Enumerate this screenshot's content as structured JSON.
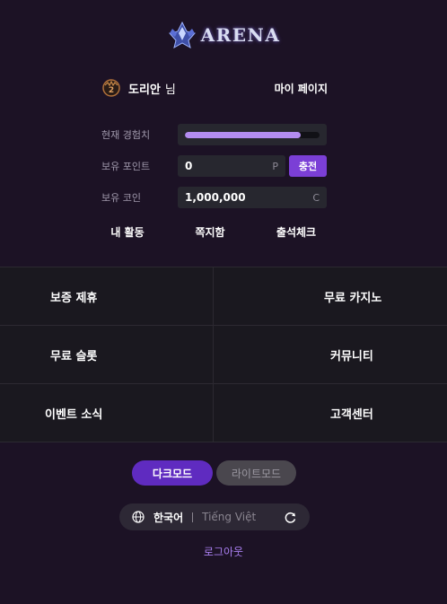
{
  "brand": {
    "logo_text": "ARENA",
    "logo_icon": "arena-emblem-icon"
  },
  "user": {
    "rank_icon": "rank-2-badge-icon",
    "name": "도리안",
    "suffix": "님",
    "mypage_label": "마이 페이지"
  },
  "stats": {
    "exp_label": "현재 경험치",
    "exp_progress": 0.86,
    "points_label": "보유 포인트",
    "points_value": "0",
    "points_unit": "P",
    "charge_label": "충전",
    "coins_label": "보유 코인",
    "coins_value": "1,000,000",
    "coins_unit": "C"
  },
  "quick_links": [
    "내 활동",
    "쪽지함",
    "출석체크"
  ],
  "menu": [
    "보증 제휴",
    "무료 카지노",
    "무료 슬롯",
    "커뮤니티",
    "이벤트 소식",
    "고객센터"
  ],
  "theme": {
    "dark_label": "다크모드",
    "light_label": "라이트모드",
    "active": "dark"
  },
  "language": {
    "globe_icon": "globe-icon",
    "korean": "한국어",
    "vietnamese": "Tiếng Việt",
    "refresh_icon": "refresh-icon"
  },
  "logout_label": "로그아웃",
  "colors": {
    "background": "#1c1225",
    "accent": "#7b3fd6",
    "exp_bar": "#b38cf0",
    "logout": "#a97ef0"
  }
}
